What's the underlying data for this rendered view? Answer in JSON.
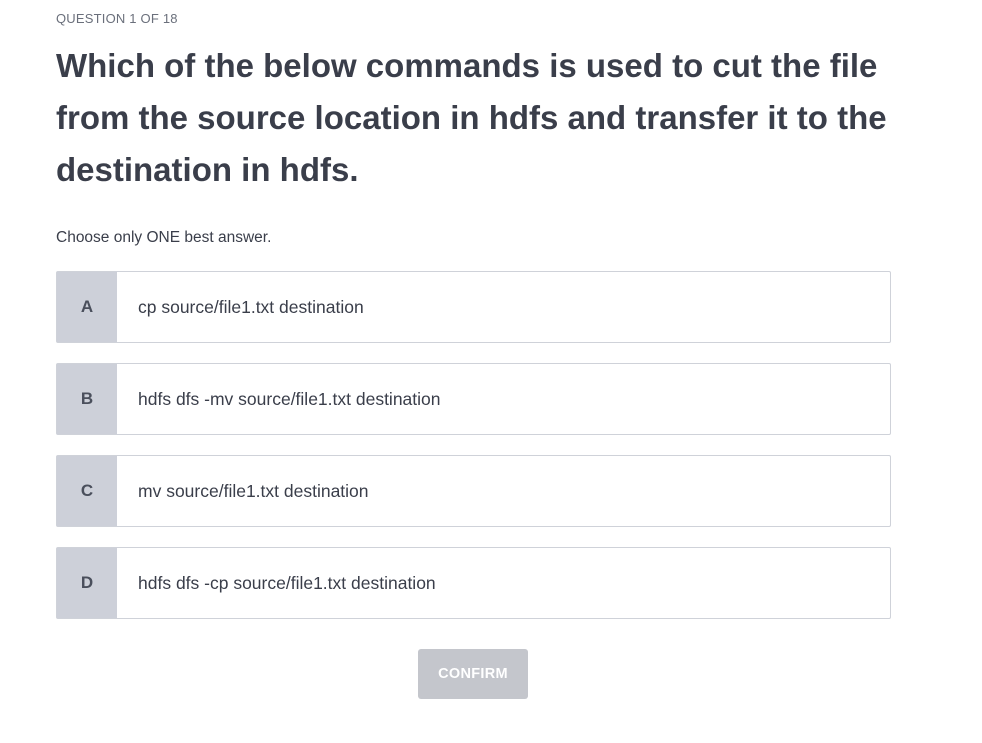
{
  "quiz": {
    "counter": "QUESTION 1 OF 18",
    "question": "Which of the below commands is used to cut the file from the source location in hdfs and transfer it to the destination in hdfs.",
    "instruction": "Choose only ONE best answer.",
    "options": [
      {
        "letter": "A",
        "text": "cp source/file1.txt destination"
      },
      {
        "letter": "B",
        "text": "hdfs dfs -mv source/file1.txt destination"
      },
      {
        "letter": "C",
        "text": "mv source/file1.txt destination"
      },
      {
        "letter": "D",
        "text": "hdfs dfs -cp source/file1.txt destination"
      }
    ],
    "confirm_label": "CONFIRM",
    "confirm_enabled": false
  },
  "colors": {
    "letter_bg": "#cdd0d9",
    "border": "#cfd2d9",
    "confirm_disabled_bg": "#c4c6cc",
    "text": "#3a3e4a"
  }
}
